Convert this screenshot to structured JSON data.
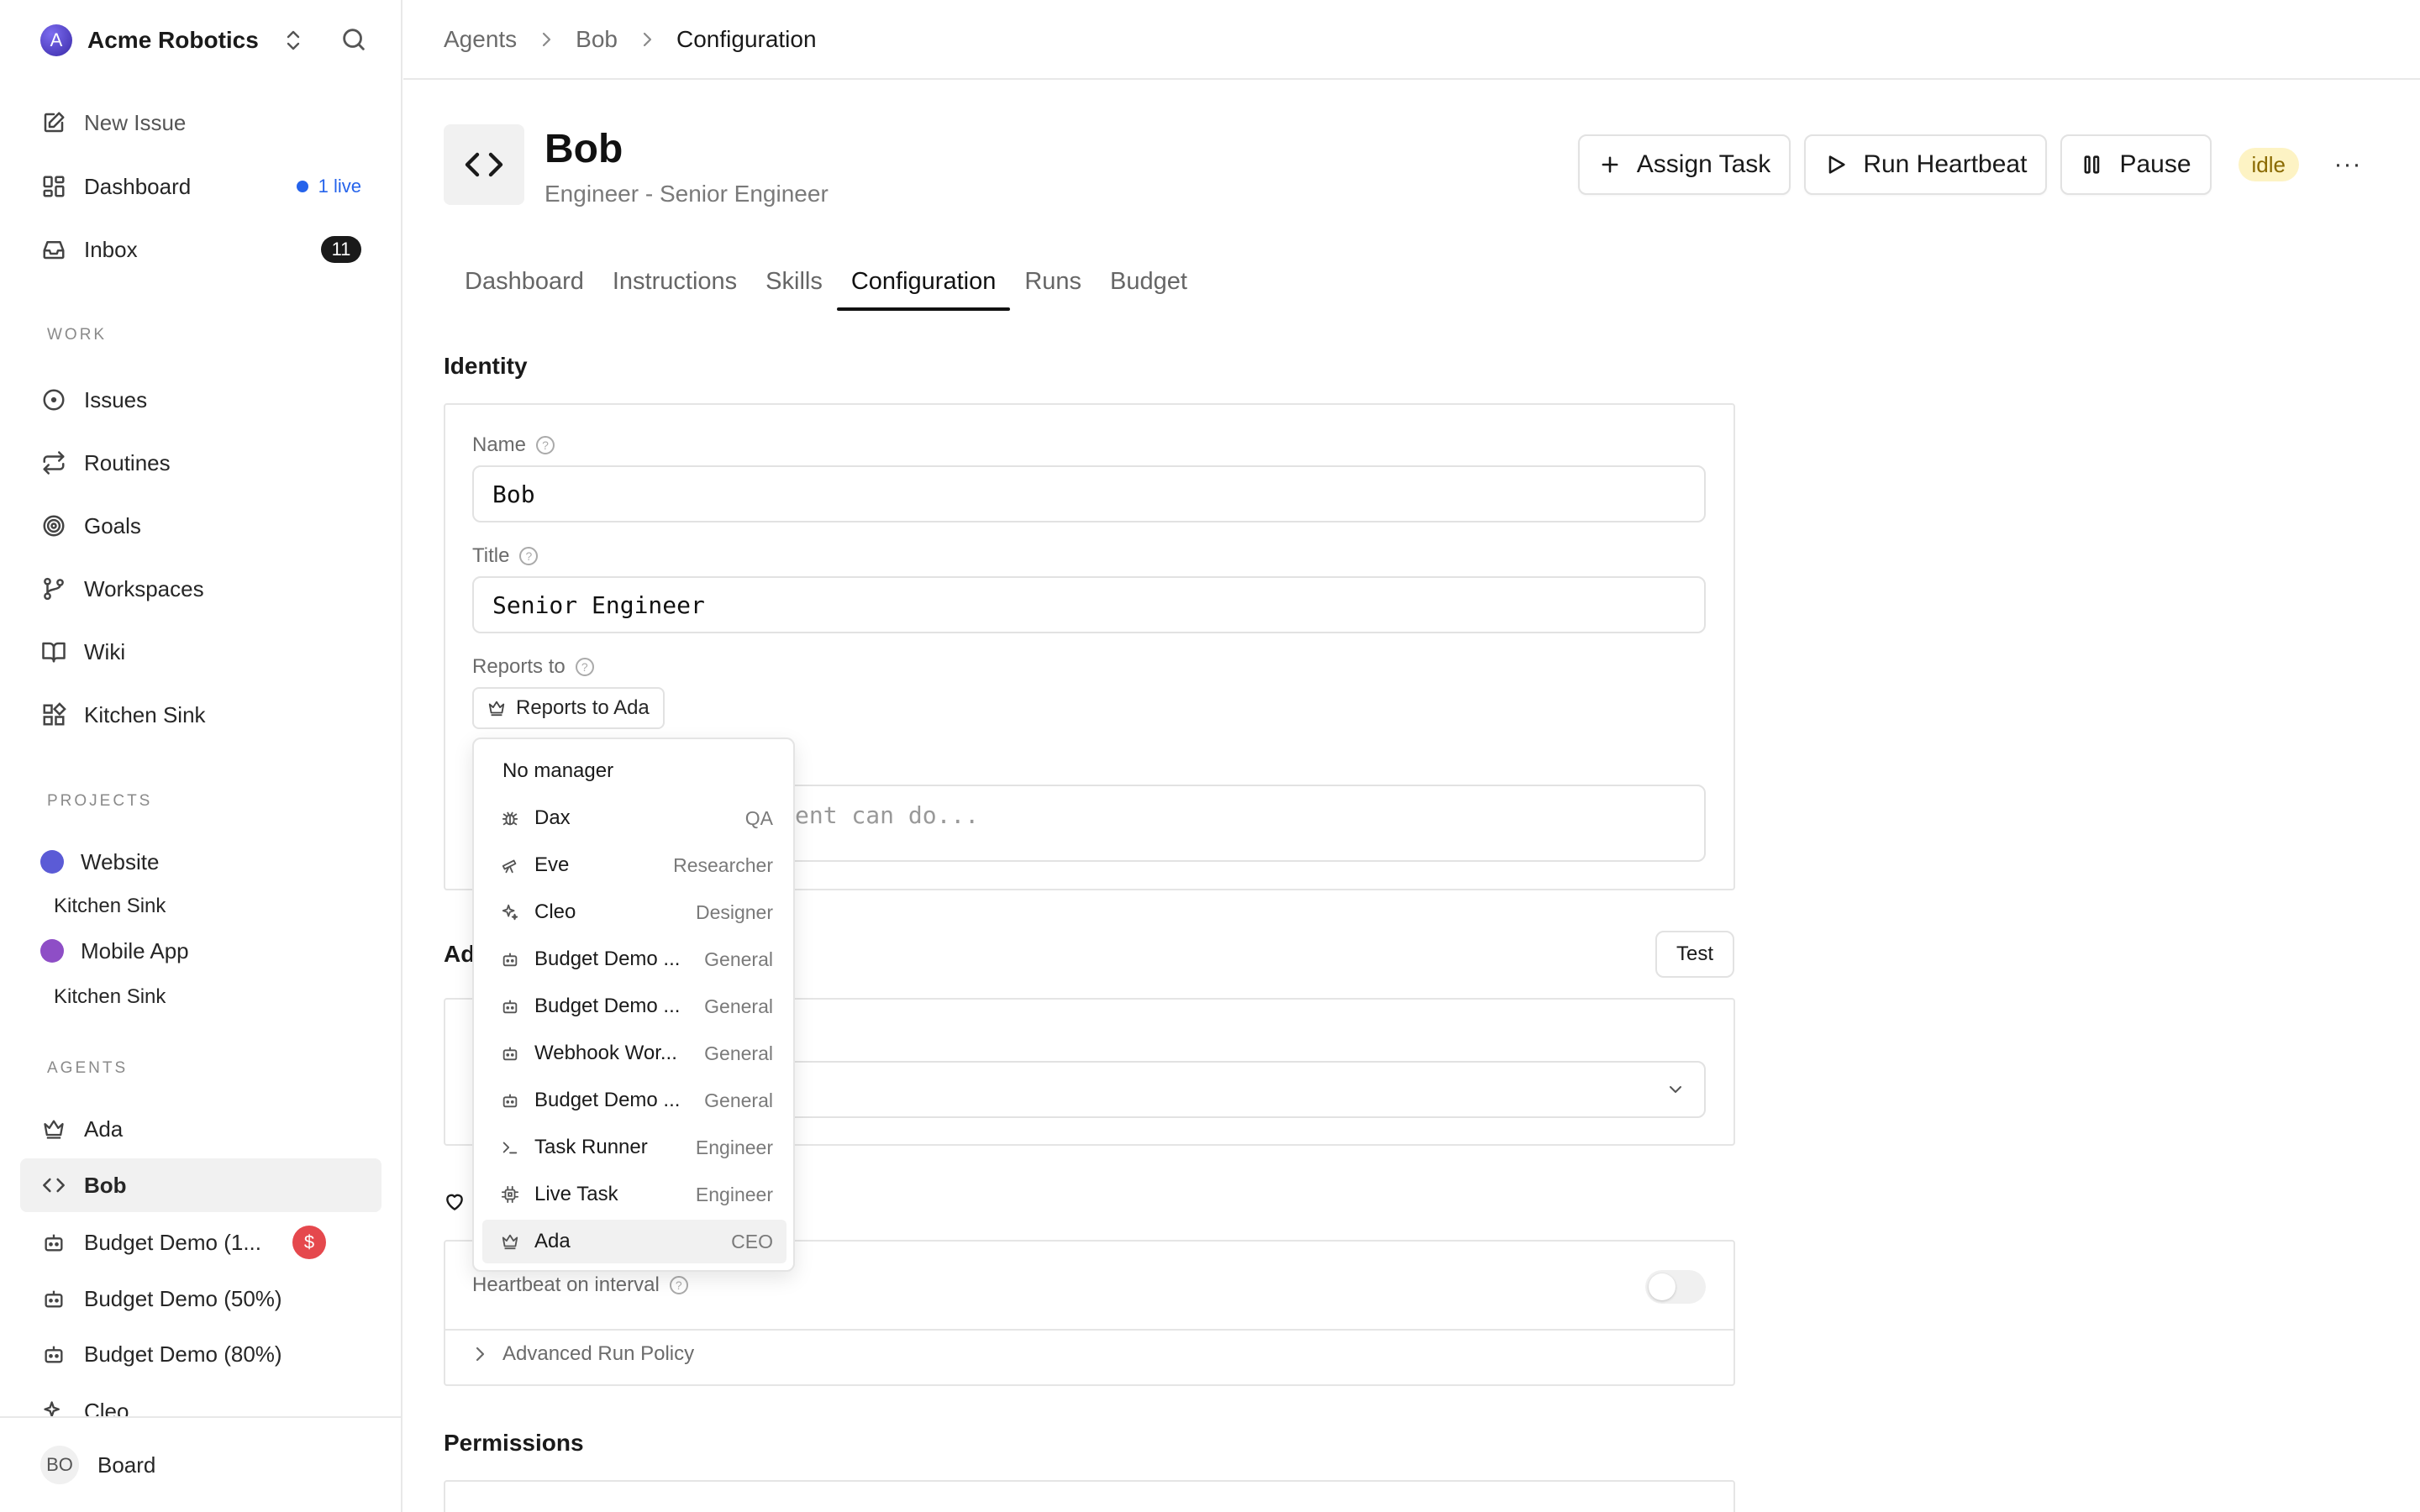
{
  "workspace": {
    "name": "Acme Robotics",
    "logo_letter": "A"
  },
  "nav": {
    "new_issue": "New Issue",
    "dashboard": "Dashboard",
    "live_badge": "1 live",
    "inbox": "Inbox",
    "inbox_count": "11"
  },
  "sections": {
    "work": "WORK",
    "projects": "PROJECTS",
    "agents": "AGENTS"
  },
  "work_items": [
    "Issues",
    "Routines",
    "Goals",
    "Workspaces",
    "Wiki",
    "Kitchen Sink"
  ],
  "projects": [
    {
      "name": "Website",
      "color": "#5b5bd6",
      "sub": "Kitchen Sink"
    },
    {
      "name": "Mobile App",
      "color": "#8e4ec6",
      "sub": "Kitchen Sink"
    }
  ],
  "agents_list": [
    "Ada",
    "Bob",
    "Budget Demo (1...",
    "Budget Demo (50%)",
    "Budget Demo (80%)",
    "Cleo"
  ],
  "agents_money_badge": "$",
  "footer": {
    "initials": "BO",
    "name": "Board"
  },
  "breadcrumb": [
    "Agents",
    "Bob",
    "Configuration"
  ],
  "agent": {
    "name": "Bob",
    "role": "Engineer - Senior Engineer",
    "status": "idle"
  },
  "actions": {
    "assign": "Assign Task",
    "run": "Run Heartbeat",
    "pause": "Pause",
    "more": "···"
  },
  "tabs": [
    "Dashboard",
    "Instructions",
    "Skills",
    "Configuration",
    "Runs",
    "Budget"
  ],
  "identity": {
    "title": "Identity",
    "name_label": "Name",
    "name_value": "Bob",
    "title_label": "Title",
    "title_value": "Senior Engineer",
    "reports_label": "Reports to",
    "reports_button": "Reports to Ada",
    "desc_placeholder_fragment": "ent can do..."
  },
  "adapter": {
    "title_fragment": "Ad",
    "test_button": "Test"
  },
  "heartbeat": {
    "interval_label": "Heartbeat on interval",
    "advanced": "Advanced Run Policy"
  },
  "permissions": {
    "title": "Permissions"
  },
  "dropdown": {
    "none_option": "No manager",
    "items": [
      {
        "name": "Dax",
        "role": "QA",
        "icon": "bug-icon"
      },
      {
        "name": "Eve",
        "role": "Researcher",
        "icon": "telescope-icon"
      },
      {
        "name": "Cleo",
        "role": "Designer",
        "icon": "sparkles-icon"
      },
      {
        "name": "Budget Demo ...",
        "role": "General",
        "icon": "bot-icon"
      },
      {
        "name": "Budget Demo ...",
        "role": "General",
        "icon": "bot-icon"
      },
      {
        "name": "Webhook Wor...",
        "role": "General",
        "icon": "bot-icon"
      },
      {
        "name": "Budget Demo ...",
        "role": "General",
        "icon": "bot-icon"
      },
      {
        "name": "Task Runner",
        "role": "Engineer",
        "icon": "terminal-icon"
      },
      {
        "name": "Live Task",
        "role": "Engineer",
        "icon": "cpu-icon"
      },
      {
        "name": "Ada",
        "role": "CEO",
        "icon": "crown-icon"
      }
    ],
    "selected_name": "Ada"
  }
}
